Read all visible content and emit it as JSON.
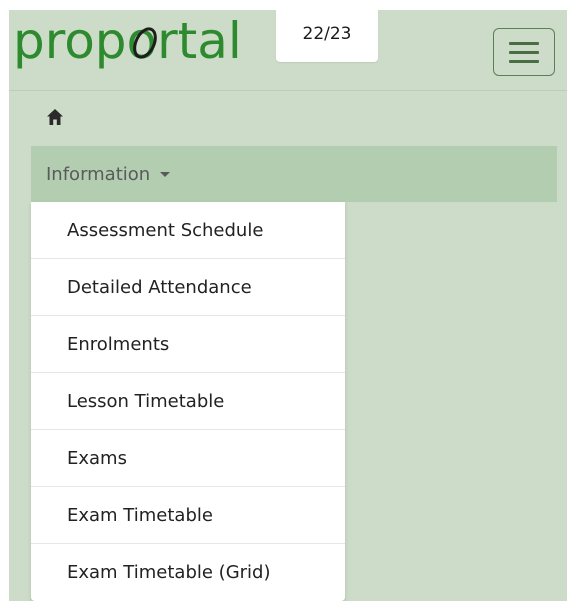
{
  "header": {
    "logo_text": "proportal",
    "academic_year": "22/23",
    "menu_toggle_icon": "hamburger-icon"
  },
  "breadcrumb": {
    "home_icon": "home-icon"
  },
  "nav": {
    "information_label": "Information",
    "caret_icon": "caret-down-icon",
    "items": [
      {
        "label": "Assessment Schedule"
      },
      {
        "label": "Detailed Attendance"
      },
      {
        "label": "Enrolments"
      },
      {
        "label": "Lesson Timetable"
      },
      {
        "label": "Exams"
      },
      {
        "label": "Exam Timetable"
      },
      {
        "label": "Exam Timetable (Grid)"
      }
    ]
  },
  "colors": {
    "page_background": "#ccdcc8",
    "info_bar": "#b3cdb0",
    "logo_green": "#2e8a2f",
    "logo_dark": "#1d1d1d",
    "hamburger": "#4a6e44"
  }
}
